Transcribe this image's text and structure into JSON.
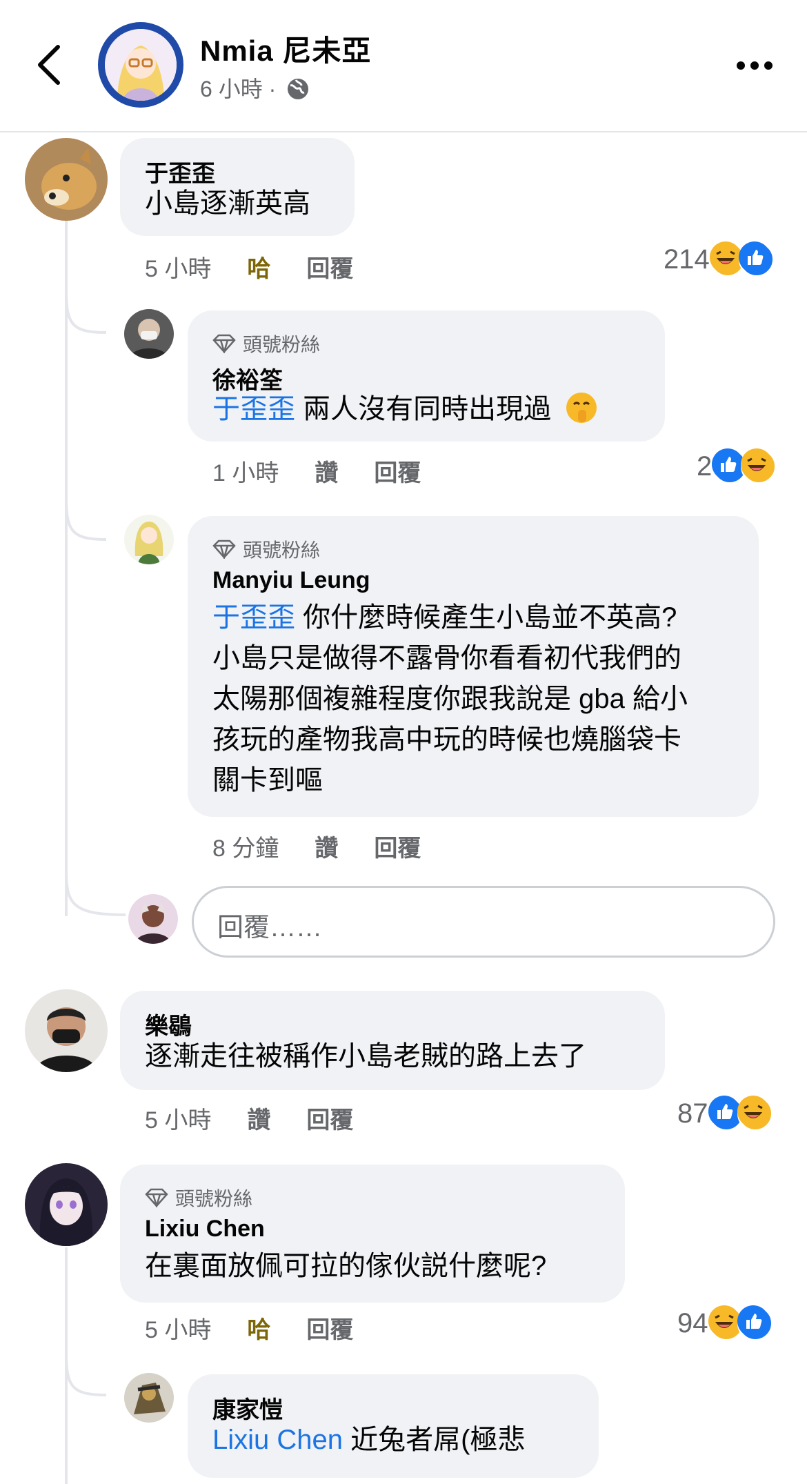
{
  "header": {
    "page_name": "Nmia 尼未亞",
    "time": "6 小時",
    "dot": "·"
  },
  "comments": [
    {
      "author": "于歪歪",
      "text": "小島逐漸英高",
      "time": "5 小時",
      "reaction_label": "哈",
      "reply_label": "回覆",
      "reaction_count": "214"
    },
    {
      "badge": "頭號粉絲",
      "author": "徐裕筌",
      "mention": "于歪歪",
      "text": "兩人沒有同時出現過",
      "time": "1 小時",
      "reaction_label": "讚",
      "reply_label": "回覆",
      "reaction_count": "2"
    },
    {
      "badge": "頭號粉絲",
      "author": "Manyiu Leung",
      "mention": "于歪歪",
      "text_line1": "你什麼時候產生小島並不英高?",
      "text_line2": "小島只是做得不露骨你看看初代我們的",
      "text_line3": "太陽那個複雜程度你跟我說是 gba 給小",
      "text_line4": "孩玩的產物我高中玩的時候也燒腦袋卡",
      "text_line5": "關卡到嘔",
      "time": "8 分鐘",
      "reaction_label": "讚",
      "reply_label": "回覆"
    },
    {
      "author": "樂鶡",
      "text": "逐漸走往被稱作小島老賊的路上去了",
      "time": "5 小時",
      "reaction_label": "讚",
      "reply_label": "回覆",
      "reaction_count": "87"
    },
    {
      "badge": "頭號粉絲",
      "author": "Lixiu Chen",
      "text": "在裏面放佩可拉的傢伙説什麼呢?",
      "time": "5 小時",
      "reaction_label": "哈",
      "reply_label": "回覆",
      "reaction_count": "94"
    },
    {
      "author": "康家愷",
      "mention": "Lixiu Chen",
      "text": "近兔者屌(極悲"
    }
  ],
  "reply_input": {
    "placeholder": "回覆……"
  }
}
